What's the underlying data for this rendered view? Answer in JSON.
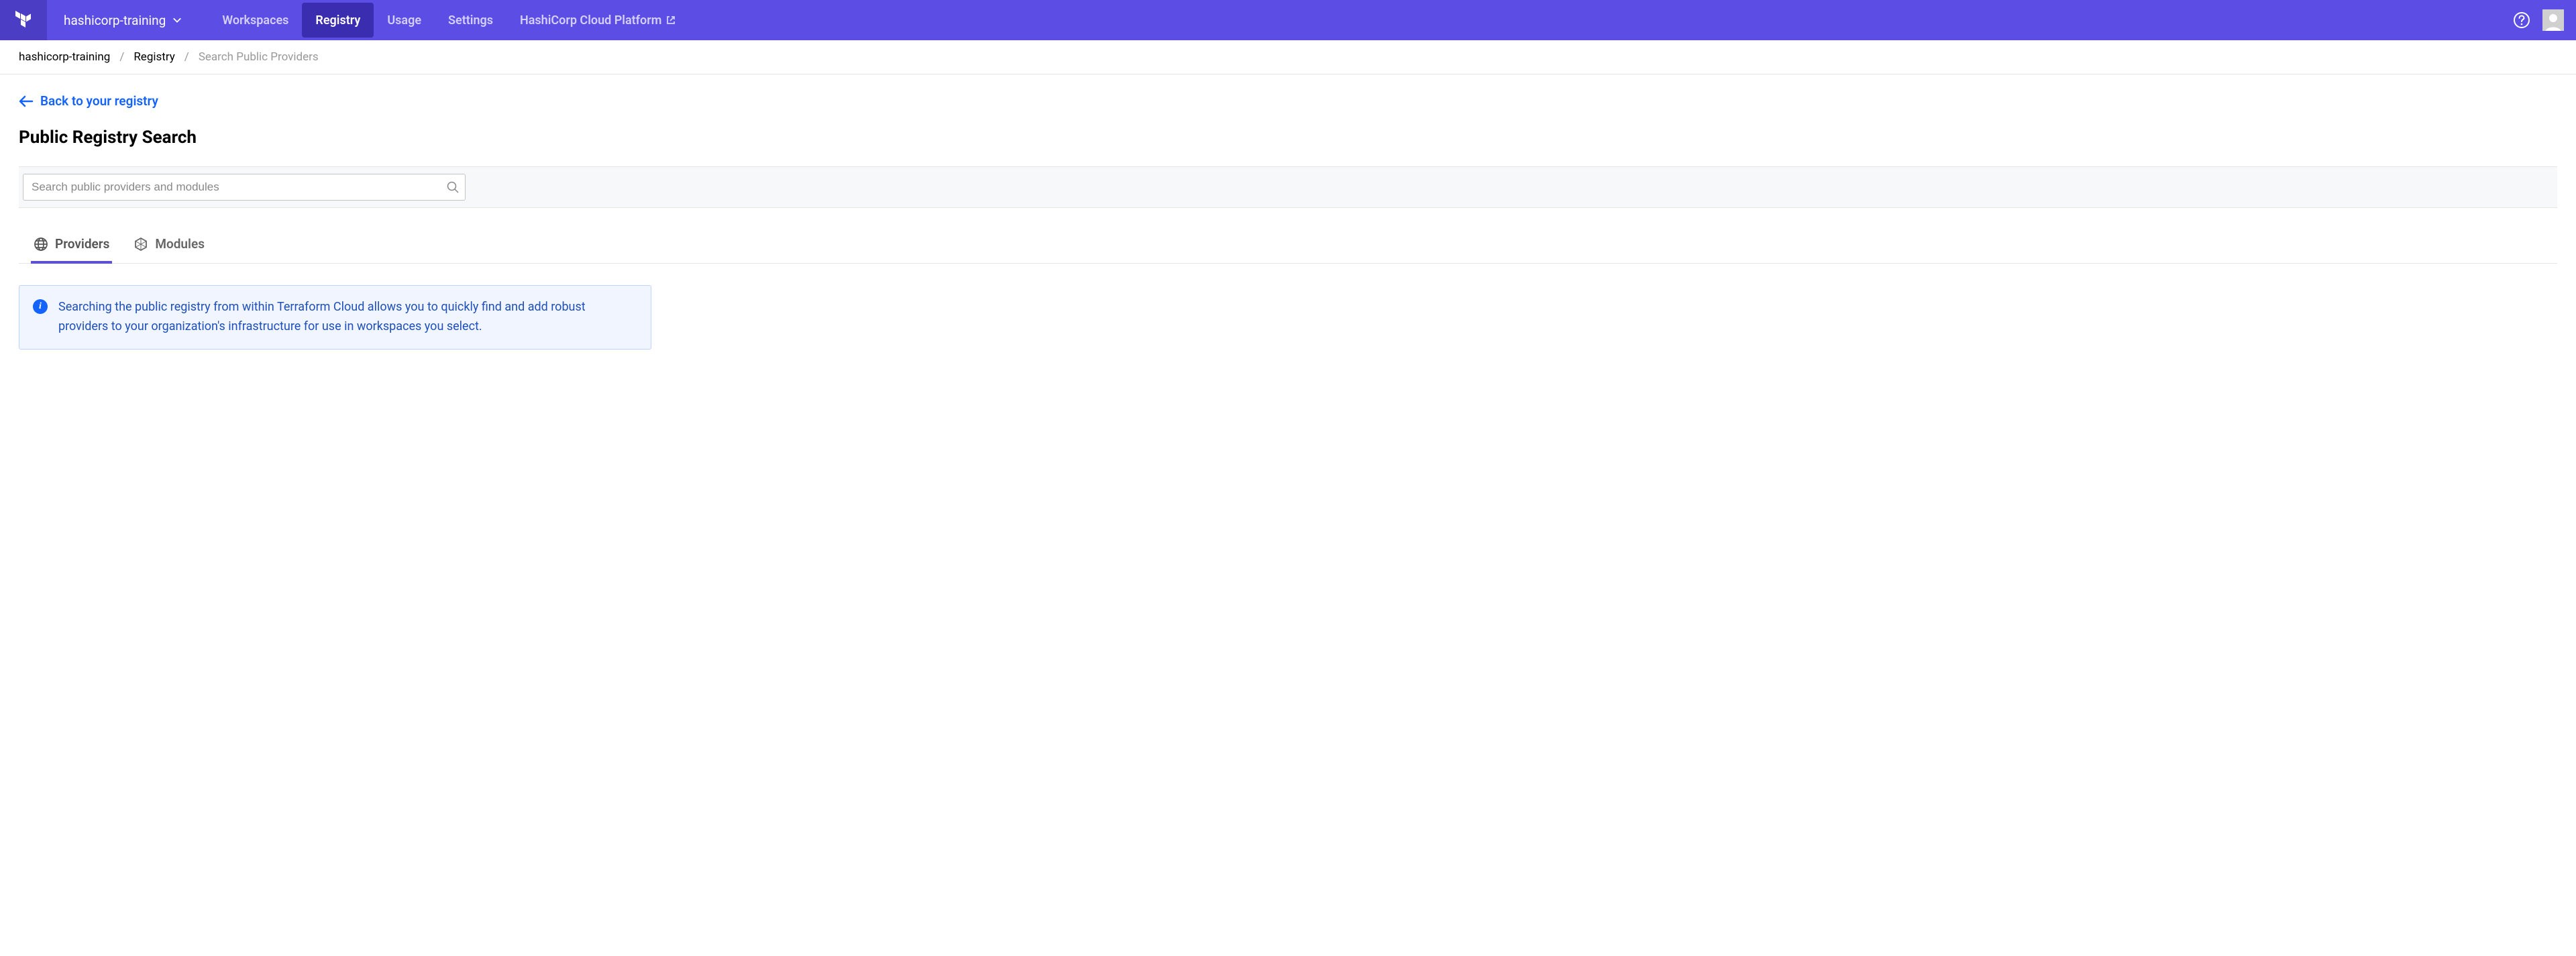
{
  "header": {
    "org_name": "hashicorp-training",
    "nav": {
      "workspaces": "Workspaces",
      "registry": "Registry",
      "usage": "Usage",
      "settings": "Settings",
      "hcp": "HashiCorp Cloud Platform"
    }
  },
  "breadcrumb": {
    "org": "hashicorp-training",
    "registry": "Registry",
    "current": "Search Public Providers"
  },
  "back_link": "Back to your registry",
  "page_title": "Public Registry Search",
  "search": {
    "placeholder": "Search public providers and modules",
    "value": ""
  },
  "tabs": {
    "providers": "Providers",
    "modules": "Modules"
  },
  "info_message": "Searching the public registry from within Terraform Cloud allows you to quickly find and add robust providers to your organization's infrastructure for use in workspaces you select."
}
